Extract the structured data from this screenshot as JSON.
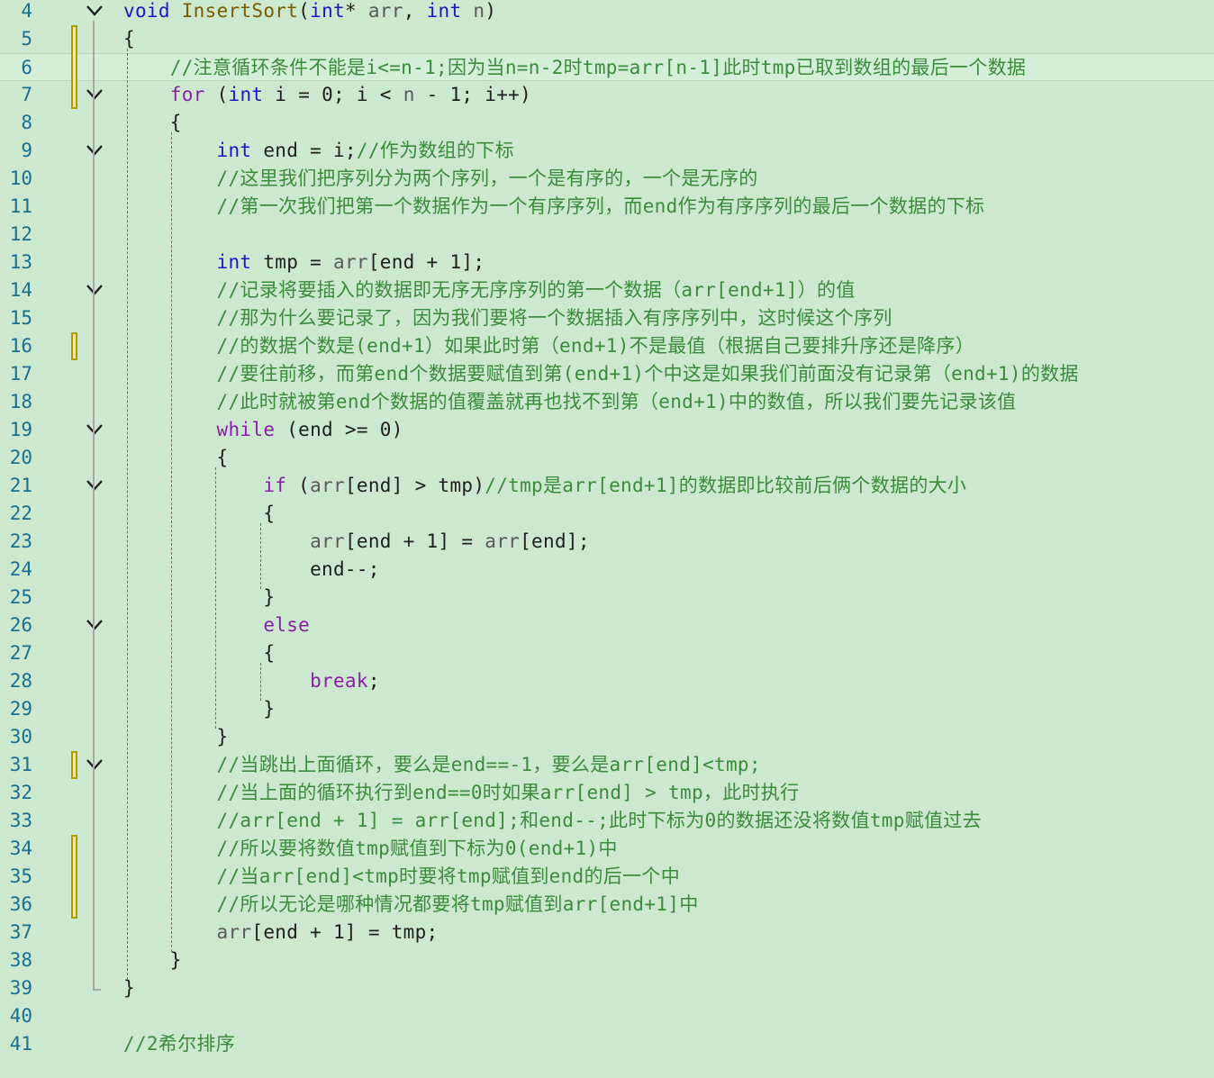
{
  "editor": {
    "background": "#CCE8CF",
    "colors": {
      "keyword": "#1E14C8",
      "control_keyword": "#8B1EA8",
      "function": "#7A5C00",
      "comment": "#3C8A3C",
      "line_number": "#1C6E8C",
      "change_marker": "#B39A00"
    },
    "lines": [
      {
        "n": "4",
        "tokens": [
          {
            "t": "void",
            "c": "kw"
          },
          {
            "t": " ",
            "c": "pl"
          },
          {
            "t": "InsertSort",
            "c": "fn"
          },
          {
            "t": "(",
            "c": "pl"
          },
          {
            "t": "int",
            "c": "kw"
          },
          {
            "t": "* ",
            "c": "pl"
          },
          {
            "t": "arr",
            "c": "pm"
          },
          {
            "t": ", ",
            "c": "pl"
          },
          {
            "t": "int",
            "c": "kw"
          },
          {
            "t": " ",
            "c": "pl"
          },
          {
            "t": "n",
            "c": "pm"
          },
          {
            "t": ")",
            "c": "pl"
          }
        ]
      },
      {
        "n": "5",
        "tokens": [
          {
            "t": "{",
            "c": "pl"
          }
        ]
      },
      {
        "n": "6",
        "tokens": [
          {
            "t": "    //注意循环条件不能是i<=n-1;因为当n=n-2时tmp=arr[n-1]此时tmp已取到数组的最后一个数据",
            "c": "cm"
          }
        ]
      },
      {
        "n": "7",
        "tokens": [
          {
            "t": "    ",
            "c": "pl"
          },
          {
            "t": "for",
            "c": "kw2"
          },
          {
            "t": " (",
            "c": "pl"
          },
          {
            "t": "int",
            "c": "kw"
          },
          {
            "t": " i = 0; i < ",
            "c": "pl"
          },
          {
            "t": "n",
            "c": "pm"
          },
          {
            "t": " - 1; i++)",
            "c": "pl"
          }
        ]
      },
      {
        "n": "8",
        "tokens": [
          {
            "t": "    {",
            "c": "pl"
          }
        ]
      },
      {
        "n": "9",
        "tokens": [
          {
            "t": "        ",
            "c": "pl"
          },
          {
            "t": "int",
            "c": "kw"
          },
          {
            "t": " end = i;",
            "c": "pl"
          },
          {
            "t": "//作为数组的下标",
            "c": "cm"
          }
        ]
      },
      {
        "n": "10",
        "tokens": [
          {
            "t": "        //这里我们把序列分为两个序列，一个是有序的，一个是无序的",
            "c": "cm"
          }
        ]
      },
      {
        "n": "11",
        "tokens": [
          {
            "t": "        //第一次我们把第一个数据作为一个有序序列，而end作为有序序列的最后一个数据的下标",
            "c": "cm"
          }
        ]
      },
      {
        "n": "12",
        "tokens": []
      },
      {
        "n": "13",
        "tokens": [
          {
            "t": "        ",
            "c": "pl"
          },
          {
            "t": "int",
            "c": "kw"
          },
          {
            "t": " tmp = ",
            "c": "pl"
          },
          {
            "t": "arr",
            "c": "pm"
          },
          {
            "t": "[end + 1];",
            "c": "pl"
          }
        ]
      },
      {
        "n": "14",
        "tokens": [
          {
            "t": "        //记录将要插入的数据即无序无序序列的第一个数据（arr[end+1]）的值",
            "c": "cm"
          }
        ]
      },
      {
        "n": "15",
        "tokens": [
          {
            "t": "        //那为什么要记录了，因为我们要将一个数据插入有序序列中，这时候这个序列",
            "c": "cm"
          }
        ]
      },
      {
        "n": "16",
        "tokens": [
          {
            "t": "        //的数据个数是(end+1）如果此时第（end+1)不是最值（根据自己要排升序还是降序）",
            "c": "cm"
          }
        ]
      },
      {
        "n": "17",
        "tokens": [
          {
            "t": "        //要往前移，而第end个数据要赋值到第(end+1)个中这是如果我们前面没有记录第（end+1)的数据",
            "c": "cm"
          }
        ]
      },
      {
        "n": "18",
        "tokens": [
          {
            "t": "        //此时就被第end个数据的值覆盖就再也找不到第（end+1)中的数值，所以我们要先记录该值",
            "c": "cm"
          }
        ]
      },
      {
        "n": "19",
        "tokens": [
          {
            "t": "        ",
            "c": "pl"
          },
          {
            "t": "while",
            "c": "kw2"
          },
          {
            "t": " (end >= 0)",
            "c": "pl"
          }
        ]
      },
      {
        "n": "20",
        "tokens": [
          {
            "t": "        {",
            "c": "pl"
          }
        ]
      },
      {
        "n": "21",
        "tokens": [
          {
            "t": "            ",
            "c": "pl"
          },
          {
            "t": "if",
            "c": "kw2"
          },
          {
            "t": " (",
            "c": "pl"
          },
          {
            "t": "arr",
            "c": "pm"
          },
          {
            "t": "[end] > tmp)",
            "c": "pl"
          },
          {
            "t": "//tmp是arr[end+1]的数据即比较前后俩个数据的大小",
            "c": "cm"
          }
        ]
      },
      {
        "n": "22",
        "tokens": [
          {
            "t": "            {",
            "c": "pl"
          }
        ]
      },
      {
        "n": "23",
        "tokens": [
          {
            "t": "                ",
            "c": "pl"
          },
          {
            "t": "arr",
            "c": "pm"
          },
          {
            "t": "[end + 1] = ",
            "c": "pl"
          },
          {
            "t": "arr",
            "c": "pm"
          },
          {
            "t": "[end];",
            "c": "pl"
          }
        ]
      },
      {
        "n": "24",
        "tokens": [
          {
            "t": "                end--;",
            "c": "pl"
          }
        ]
      },
      {
        "n": "25",
        "tokens": [
          {
            "t": "            }",
            "c": "pl"
          }
        ]
      },
      {
        "n": "26",
        "tokens": [
          {
            "t": "            ",
            "c": "pl"
          },
          {
            "t": "else",
            "c": "kw2"
          }
        ]
      },
      {
        "n": "27",
        "tokens": [
          {
            "t": "            {",
            "c": "pl"
          }
        ]
      },
      {
        "n": "28",
        "tokens": [
          {
            "t": "                ",
            "c": "pl"
          },
          {
            "t": "break",
            "c": "kw2"
          },
          {
            "t": ";",
            "c": "pl"
          }
        ]
      },
      {
        "n": "29",
        "tokens": [
          {
            "t": "            }",
            "c": "pl"
          }
        ]
      },
      {
        "n": "30",
        "tokens": [
          {
            "t": "        }",
            "c": "pl"
          }
        ]
      },
      {
        "n": "31",
        "tokens": [
          {
            "t": "        //当跳出上面循环，要么是end==-1，要么是arr[end]<tmp;",
            "c": "cm"
          }
        ]
      },
      {
        "n": "32",
        "tokens": [
          {
            "t": "        //当上面的循环执行到end==0时如果arr[end] > tmp，此时执行",
            "c": "cm"
          }
        ]
      },
      {
        "n": "33",
        "tokens": [
          {
            "t": "        //arr[end + 1] = arr[end];和end--;此时下标为0的数据还没将数值tmp赋值过去",
            "c": "cm"
          }
        ]
      },
      {
        "n": "34",
        "tokens": [
          {
            "t": "        //所以要将数值tmp赋值到下标为0(end+1)中",
            "c": "cm"
          }
        ]
      },
      {
        "n": "35",
        "tokens": [
          {
            "t": "        //当arr[end]<tmp时要将tmp赋值到end的后一个中",
            "c": "cm"
          }
        ]
      },
      {
        "n": "36",
        "tokens": [
          {
            "t": "        //所以无论是哪种情况都要将tmp赋值到arr[end+1]中",
            "c": "cm"
          }
        ]
      },
      {
        "n": "37",
        "tokens": [
          {
            "t": "        ",
            "c": "pl"
          },
          {
            "t": "arr",
            "c": "pm"
          },
          {
            "t": "[end + 1] = tmp;",
            "c": "pl"
          }
        ]
      },
      {
        "n": "38",
        "tokens": [
          {
            "t": "    }",
            "c": "pl"
          }
        ]
      },
      {
        "n": "39",
        "tokens": [
          {
            "t": "}",
            "c": "pl"
          }
        ]
      },
      {
        "n": "40",
        "tokens": []
      },
      {
        "n": "41",
        "tokens": [
          {
            "t": "//2希尔排序",
            "c": "cm"
          }
        ]
      }
    ]
  }
}
